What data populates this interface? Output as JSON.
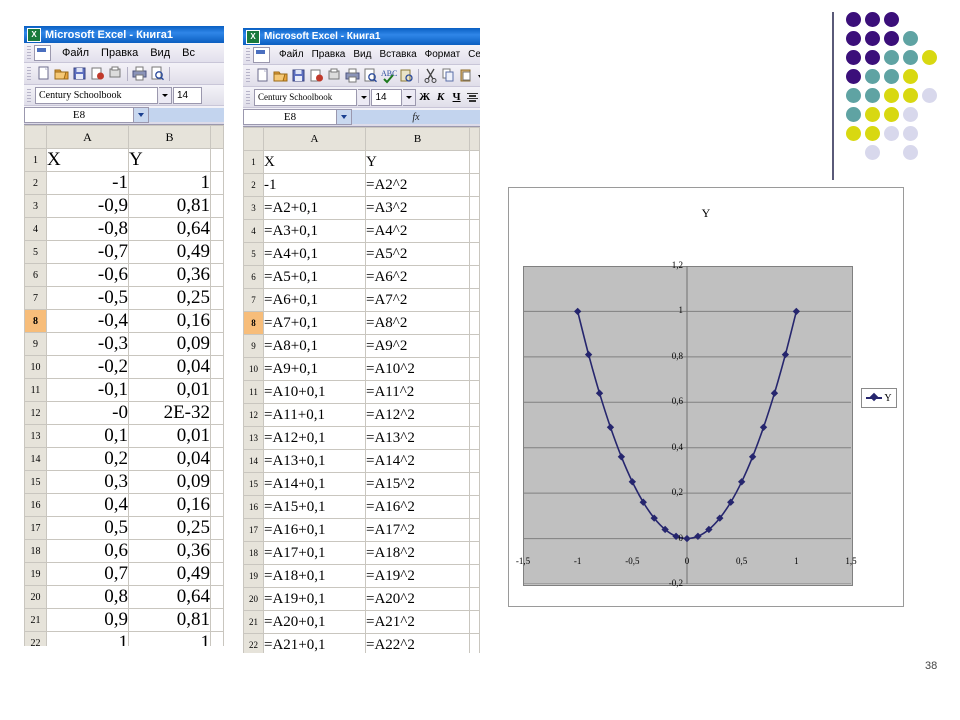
{
  "slide": {
    "page_number": "38",
    "background": "#ffffff"
  },
  "window1": {
    "title": "Microsoft Excel - Книга1",
    "logo_glyph": "X",
    "menu": [
      "Файл",
      "Правка",
      "Вид",
      "Вс"
    ],
    "font_name": "Century Schoolbook",
    "font_size": "14",
    "name_box": "E8",
    "columns": [
      "A",
      "B"
    ],
    "rows": [
      {
        "n": "1",
        "a": "X",
        "b": "Y",
        "align": "left",
        "selected": false
      },
      {
        "n": "2",
        "a": "-1",
        "b": "1",
        "align": "right",
        "selected": false
      },
      {
        "n": "3",
        "a": "-0,9",
        "b": "0,81",
        "align": "right",
        "selected": false
      },
      {
        "n": "4",
        "a": "-0,8",
        "b": "0,64",
        "align": "right",
        "selected": false
      },
      {
        "n": "5",
        "a": "-0,7",
        "b": "0,49",
        "align": "right",
        "selected": false
      },
      {
        "n": "6",
        "a": "-0,6",
        "b": "0,36",
        "align": "right",
        "selected": false
      },
      {
        "n": "7",
        "a": "-0,5",
        "b": "0,25",
        "align": "right",
        "selected": false
      },
      {
        "n": "8",
        "a": "-0,4",
        "b": "0,16",
        "align": "right",
        "selected": true
      },
      {
        "n": "9",
        "a": "-0,3",
        "b": "0,09",
        "align": "right",
        "selected": false
      },
      {
        "n": "10",
        "a": "-0,2",
        "b": "0,04",
        "align": "right",
        "selected": false
      },
      {
        "n": "11",
        "a": "-0,1",
        "b": "0,01",
        "align": "right",
        "selected": false
      },
      {
        "n": "12",
        "a": "-0",
        "b": "2E-32",
        "align": "right",
        "selected": false
      },
      {
        "n": "13",
        "a": "0,1",
        "b": "0,01",
        "align": "right",
        "selected": false
      },
      {
        "n": "14",
        "a": "0,2",
        "b": "0,04",
        "align": "right",
        "selected": false
      },
      {
        "n": "15",
        "a": "0,3",
        "b": "0,09",
        "align": "right",
        "selected": false
      },
      {
        "n": "16",
        "a": "0,4",
        "b": "0,16",
        "align": "right",
        "selected": false
      },
      {
        "n": "17",
        "a": "0,5",
        "b": "0,25",
        "align": "right",
        "selected": false
      },
      {
        "n": "18",
        "a": "0,6",
        "b": "0,36",
        "align": "right",
        "selected": false
      },
      {
        "n": "19",
        "a": "0,7",
        "b": "0,49",
        "align": "right",
        "selected": false
      },
      {
        "n": "20",
        "a": "0,8",
        "b": "0,64",
        "align": "right",
        "selected": false
      },
      {
        "n": "21",
        "a": "0,9",
        "b": "0,81",
        "align": "right",
        "selected": false
      },
      {
        "n": "22",
        "a": "1",
        "b": "1",
        "align": "right",
        "selected": false
      }
    ]
  },
  "window2": {
    "title": "Microsoft Excel - Книга1",
    "logo_glyph": "X",
    "menu": [
      "Файл",
      "Правка",
      "Вид",
      "Вставка",
      "Формат",
      "Серв"
    ],
    "font_name": "Century Schoolbook",
    "font_size": "14",
    "name_box": "E8",
    "fx_label": "fx",
    "bold_label": "Ж",
    "italic_label": "К",
    "underline_label": "Ч",
    "columns": [
      "A",
      "B"
    ],
    "rows": [
      {
        "n": "1",
        "a": "X",
        "b": "Y",
        "selected": false
      },
      {
        "n": "2",
        "a": "-1",
        "b": "=A2^2",
        "selected": false
      },
      {
        "n": "3",
        "a": "=A2+0,1",
        "b": "=A3^2",
        "selected": false
      },
      {
        "n": "4",
        "a": "=A3+0,1",
        "b": "=A4^2",
        "selected": false
      },
      {
        "n": "5",
        "a": "=A4+0,1",
        "b": "=A5^2",
        "selected": false
      },
      {
        "n": "6",
        "a": "=A5+0,1",
        "b": "=A6^2",
        "selected": false
      },
      {
        "n": "7",
        "a": "=A6+0,1",
        "b": "=A7^2",
        "selected": false
      },
      {
        "n": "8",
        "a": "=A7+0,1",
        "b": "=A8^2",
        "selected": true
      },
      {
        "n": "9",
        "a": "=A8+0,1",
        "b": "=A9^2",
        "selected": false
      },
      {
        "n": "10",
        "a": "=A9+0,1",
        "b": "=A10^2",
        "selected": false
      },
      {
        "n": "11",
        "a": "=A10+0,1",
        "b": "=A11^2",
        "selected": false
      },
      {
        "n": "12",
        "a": "=A11+0,1",
        "b": "=A12^2",
        "selected": false
      },
      {
        "n": "13",
        "a": "=A12+0,1",
        "b": "=A13^2",
        "selected": false
      },
      {
        "n": "14",
        "a": "=A13+0,1",
        "b": "=A14^2",
        "selected": false
      },
      {
        "n": "15",
        "a": "=A14+0,1",
        "b": "=A15^2",
        "selected": false
      },
      {
        "n": "16",
        "a": "=A15+0,1",
        "b": "=A16^2",
        "selected": false
      },
      {
        "n": "17",
        "a": "=A16+0,1",
        "b": "=A17^2",
        "selected": false
      },
      {
        "n": "18",
        "a": "=A17+0,1",
        "b": "=A18^2",
        "selected": false
      },
      {
        "n": "19",
        "a": "=A18+0,1",
        "b": "=A19^2",
        "selected": false
      },
      {
        "n": "20",
        "a": "=A19+0,1",
        "b": "=A20^2",
        "selected": false
      },
      {
        "n": "21",
        "a": "=A20+0,1",
        "b": "=A21^2",
        "selected": false
      },
      {
        "n": "22",
        "a": "=A21+0,1",
        "b": "=A22^2",
        "selected": false
      }
    ]
  },
  "chart_data": {
    "type": "line",
    "title": "Y",
    "xlabel": "",
    "ylabel": "",
    "legend": [
      "Y"
    ],
    "legend_position": "right",
    "grid": true,
    "plot_bgcolor": "#c0c0c0",
    "series_color": "#26266e",
    "marker": "diamond",
    "xlim": [
      -1.5,
      1.5
    ],
    "ylim": [
      -0.2,
      1.2
    ],
    "xticks": [
      "-1,5",
      "-1",
      "-0,5",
      "0",
      "0,5",
      "1",
      "1,5"
    ],
    "xtick_values": [
      -1.5,
      -1,
      -0.5,
      0,
      0.5,
      1,
      1.5
    ],
    "yticks": [
      "-0,2",
      "0",
      "0,2",
      "0,4",
      "0,6",
      "0,8",
      "1",
      "1,2"
    ],
    "ytick_values": [
      -0.2,
      0,
      0.2,
      0.4,
      0.6,
      0.8,
      1,
      1.2
    ],
    "x": [
      -1,
      -0.9,
      -0.8,
      -0.7,
      -0.6,
      -0.5,
      -0.4,
      -0.3,
      -0.2,
      -0.1,
      0,
      0.1,
      0.2,
      0.3,
      0.4,
      0.5,
      0.6,
      0.7,
      0.8,
      0.9,
      1
    ],
    "series": [
      {
        "name": "Y",
        "values": [
          1,
          0.81,
          0.64,
          0.49,
          0.36,
          0.25,
          0.16,
          0.09,
          0.04,
          0.01,
          0,
          0.01,
          0.04,
          0.09,
          0.16,
          0.25,
          0.36,
          0.49,
          0.64,
          0.81,
          1
        ]
      }
    ]
  },
  "decoration": {
    "accent_purple": "#3b0f7a",
    "accent_teal": "#5fa3a3",
    "accent_yellow": "#d8d811",
    "accent_lavender": "#d8d8ec",
    "rule_color": "#5a5a78",
    "dots": [
      {
        "row": 0,
        "col": 0,
        "color": "#3b0f7a"
      },
      {
        "row": 0,
        "col": 1,
        "color": "#3b0f7a"
      },
      {
        "row": 0,
        "col": 2,
        "color": "#3b0f7a"
      },
      {
        "row": 1,
        "col": 0,
        "color": "#3b0f7a"
      },
      {
        "row": 1,
        "col": 1,
        "color": "#3b0f7a"
      },
      {
        "row": 1,
        "col": 2,
        "color": "#3b0f7a"
      },
      {
        "row": 1,
        "col": 3,
        "color": "#5fa3a3"
      },
      {
        "row": 2,
        "col": 0,
        "color": "#3b0f7a"
      },
      {
        "row": 2,
        "col": 1,
        "color": "#3b0f7a"
      },
      {
        "row": 2,
        "col": 2,
        "color": "#5fa3a3"
      },
      {
        "row": 2,
        "col": 3,
        "color": "#5fa3a3"
      },
      {
        "row": 2,
        "col": 4,
        "color": "#d8d811"
      },
      {
        "row": 3,
        "col": 0,
        "color": "#3b0f7a"
      },
      {
        "row": 3,
        "col": 1,
        "color": "#5fa3a3"
      },
      {
        "row": 3,
        "col": 2,
        "color": "#5fa3a3"
      },
      {
        "row": 3,
        "col": 3,
        "color": "#d8d811"
      },
      {
        "row": 4,
        "col": 0,
        "color": "#5fa3a3"
      },
      {
        "row": 4,
        "col": 1,
        "color": "#5fa3a3"
      },
      {
        "row": 4,
        "col": 2,
        "color": "#d8d811"
      },
      {
        "row": 4,
        "col": 3,
        "color": "#d8d811"
      },
      {
        "row": 4,
        "col": 4,
        "color": "#d8d8ec"
      },
      {
        "row": 5,
        "col": 0,
        "color": "#5fa3a3"
      },
      {
        "row": 5,
        "col": 1,
        "color": "#d8d811"
      },
      {
        "row": 5,
        "col": 2,
        "color": "#d8d811"
      },
      {
        "row": 5,
        "col": 3,
        "color": "#d8d8ec"
      },
      {
        "row": 6,
        "col": 0,
        "color": "#d8d811"
      },
      {
        "row": 6,
        "col": 1,
        "color": "#d8d811"
      },
      {
        "row": 6,
        "col": 2,
        "color": "#d8d8ec"
      },
      {
        "row": 6,
        "col": 3,
        "color": "#d8d8ec"
      },
      {
        "row": 7,
        "col": 1,
        "color": "#d8d8ec"
      },
      {
        "row": 7,
        "col": 3,
        "color": "#d8d8ec"
      }
    ]
  }
}
